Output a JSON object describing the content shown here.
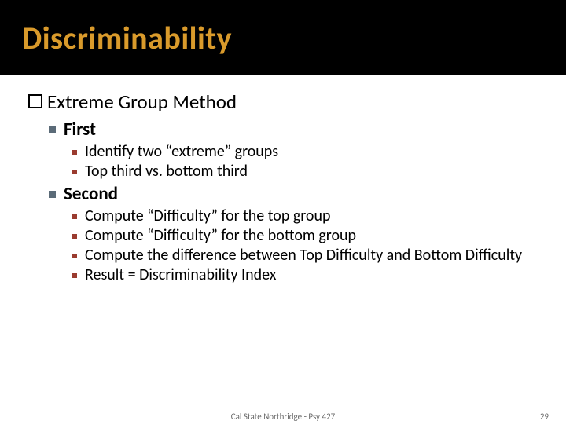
{
  "title": "Discriminability",
  "lvl1": {
    "text": "Extreme Group Method"
  },
  "first": {
    "heading": "First",
    "items": [
      "Identify two “extreme” groups",
      "Top third vs. bottom third"
    ]
  },
  "second": {
    "heading": "Second",
    "items": [
      "Compute “Difficulty” for the top group",
      "Compute “Difficulty” for the bottom group",
      "Compute the difference between Top Difficulty and Bottom Difficulty",
      "Result = Discriminability Index"
    ]
  },
  "footer": {
    "center": "Cal State Northridge - Psy 427",
    "page": "29"
  }
}
